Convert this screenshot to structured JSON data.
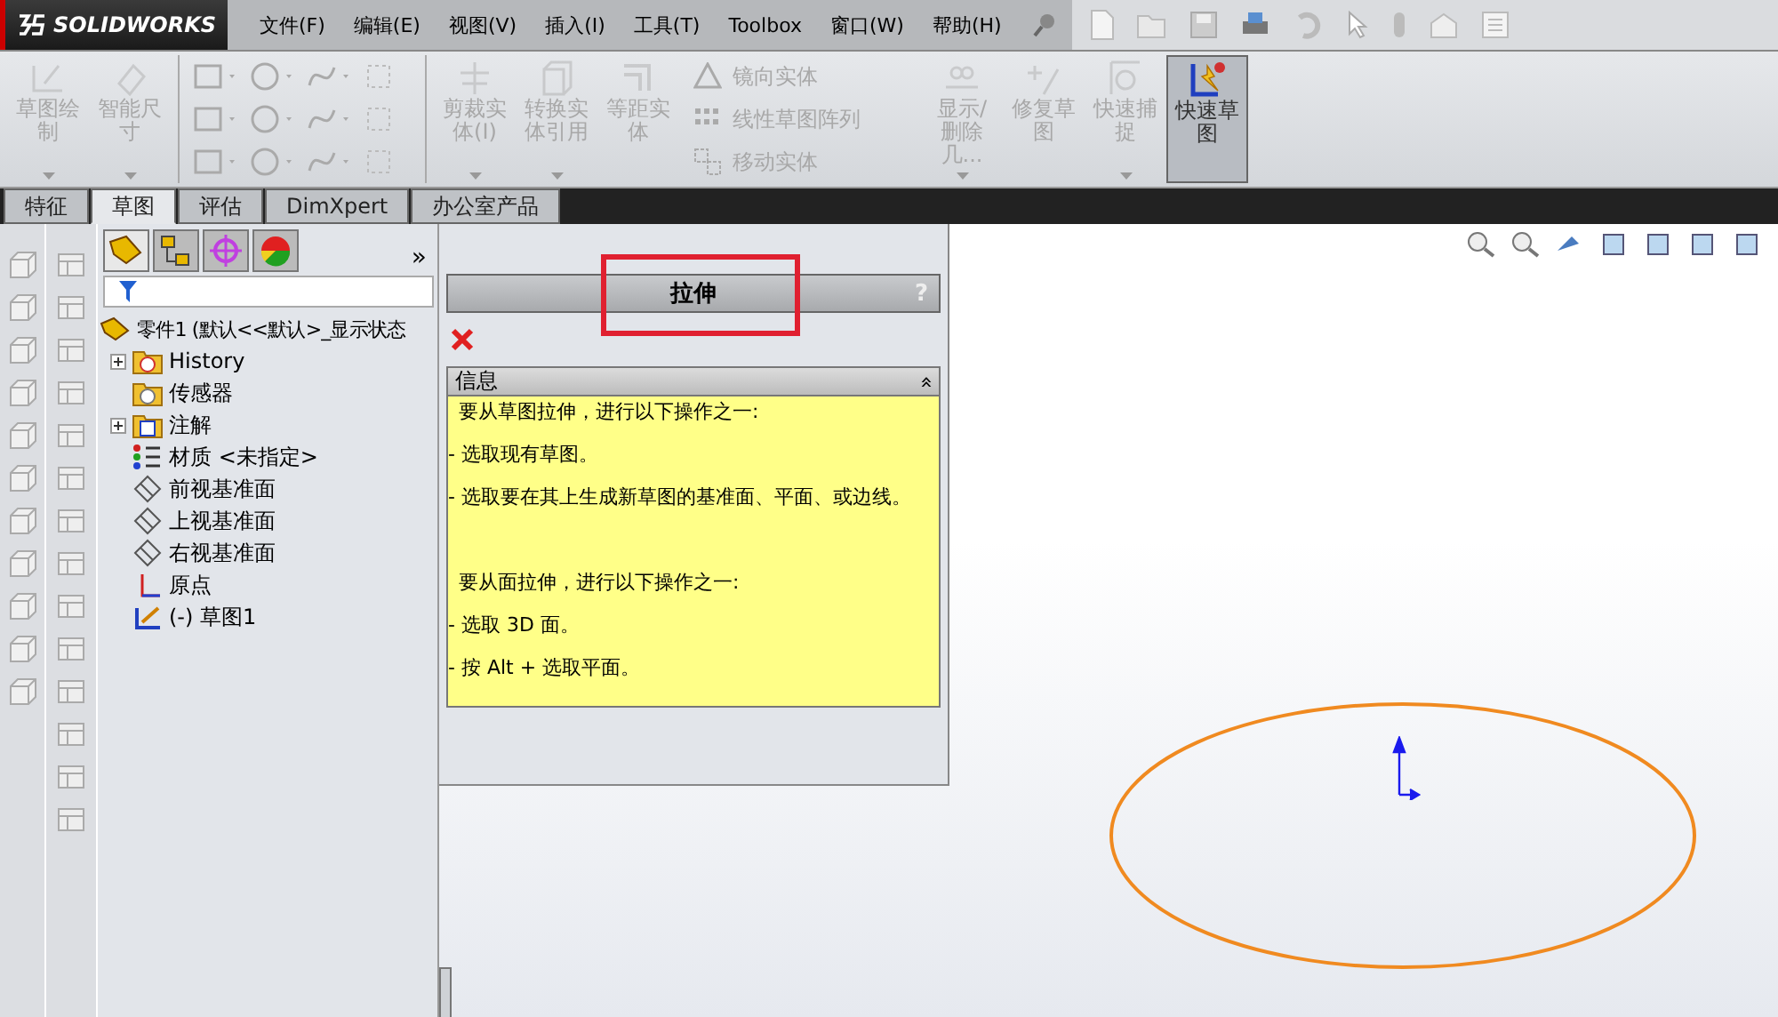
{
  "app": {
    "logo": "SOLIDWORKS"
  },
  "menu": [
    "文件(F)",
    "编辑(E)",
    "视图(V)",
    "插入(I)",
    "工具(T)",
    "Toolbox",
    "窗口(W)",
    "帮助(H)"
  ],
  "command_manager": {
    "buttons": [
      {
        "kind": "sketch",
        "label": "草图绘制",
        "disabled": true,
        "selected": false,
        "dropdown": true
      },
      {
        "kind": "dimension",
        "label": "智能尺寸",
        "disabled": true,
        "selected": false,
        "dropdown": true
      },
      {
        "kind": "tools"
      },
      {
        "kind": "trim",
        "label": "剪裁实体(I)",
        "disabled": true,
        "selected": false,
        "dropdown": true
      },
      {
        "kind": "convert",
        "label": "转换实体引用",
        "disabled": true,
        "selected": false,
        "dropdown": true
      },
      {
        "kind": "offset",
        "label": "等距实体",
        "disabled": true,
        "selected": false
      },
      {
        "kind": "list",
        "disabled": true,
        "items": [
          "镜向实体",
          "线性草图阵列",
          "移动实体"
        ]
      },
      {
        "kind": "relations",
        "label": "显示/删除几...",
        "disabled": true,
        "selected": false,
        "dropdown": true
      },
      {
        "kind": "repair",
        "label": "修复草图",
        "disabled": true,
        "selected": false
      },
      {
        "kind": "snap",
        "label": "快速捕捉",
        "disabled": true,
        "selected": false,
        "dropdown": true
      },
      {
        "kind": "rapid",
        "label": "快速草图",
        "disabled": false,
        "selected": true
      }
    ]
  },
  "tabs": [
    {
      "label": "特征",
      "selected": false
    },
    {
      "label": "草图",
      "selected": true
    },
    {
      "label": "评估",
      "selected": false
    },
    {
      "label": "DimXpert",
      "selected": false
    },
    {
      "label": "办公室产品",
      "selected": false
    }
  ],
  "feature_tree": {
    "more": "»",
    "root": {
      "kind": "part",
      "label": "零件1  (默认<<默认>_显示状态",
      "children": [
        {
          "kind": "history",
          "label": "History",
          "expanded": false
        },
        {
          "kind": "sensor",
          "label": "传感器"
        },
        {
          "kind": "annotation",
          "label": "注解",
          "expanded": false
        },
        {
          "kind": "material",
          "label": "材质 <未指定>"
        },
        {
          "kind": "plane",
          "label": "前视基准面"
        },
        {
          "kind": "plane",
          "label": "上视基准面"
        },
        {
          "kind": "plane",
          "label": "右视基准面"
        },
        {
          "kind": "origin",
          "label": "原点"
        },
        {
          "kind": "sketch",
          "label": "(-) 草图1"
        }
      ]
    }
  },
  "property_manager": {
    "title": "拉伸",
    "help": "?",
    "title_highlighted": true,
    "info": {
      "title": "信息",
      "collapse": "»",
      "paragraphs": [
        {
          "kind": "heading",
          "text": "要从草图拉伸，进行以下操作之一:"
        },
        {
          "kind": "item",
          "text": "- 选取现有草图。"
        },
        {
          "kind": "item",
          "text": "- 选取要在其上生成新草图的基准面、平面、或边线。"
        },
        {
          "kind": "heading",
          "text": "要从面拉伸，进行以下操作之一:",
          "gap": true
        },
        {
          "kind": "item",
          "text": "- 选取 3D 面。"
        },
        {
          "kind": "item",
          "text": "- 按 Alt + 选取平面。"
        }
      ]
    }
  }
}
